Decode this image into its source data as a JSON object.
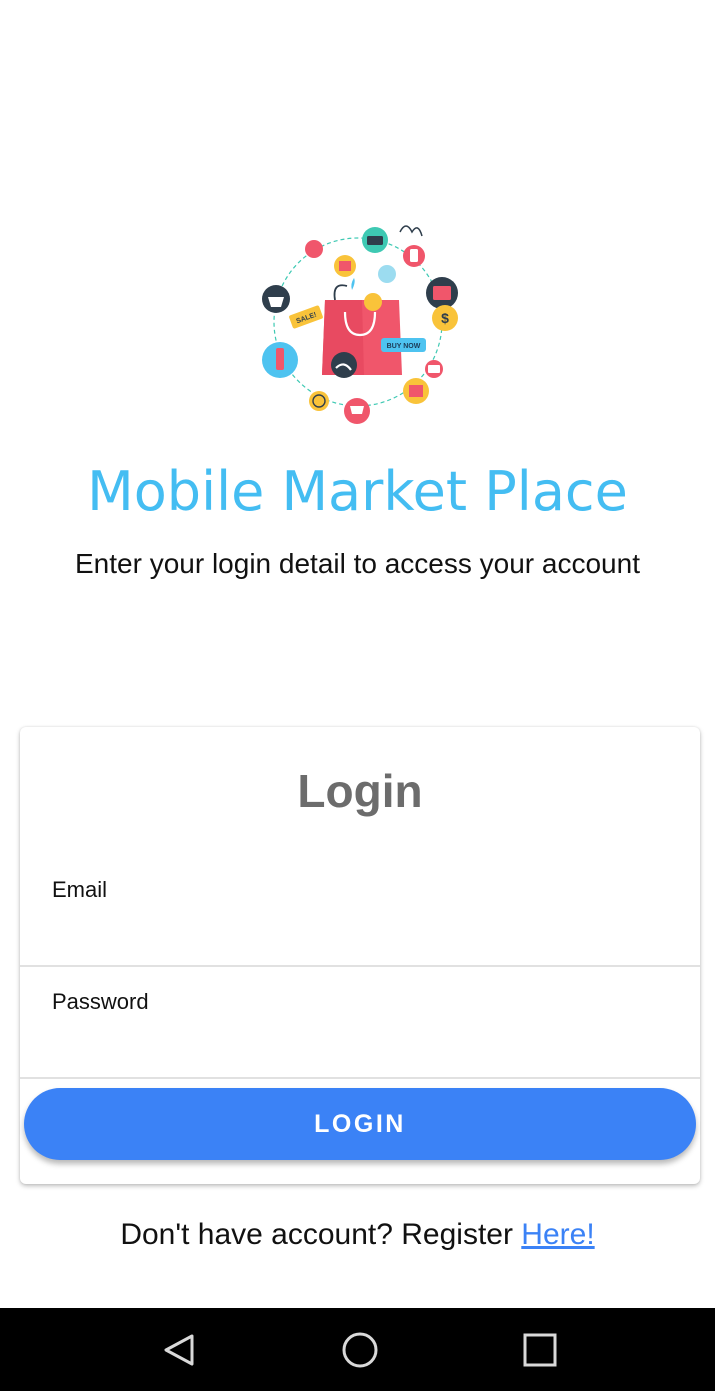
{
  "app": {
    "title": "Mobile Market Place",
    "subtitle": "Enter your login detail to access your account"
  },
  "hero": {
    "icon": "shopping-illustration",
    "sale_tag": "SALE!",
    "buy_now_tag": "BUY NOW"
  },
  "login_card": {
    "title": "Login",
    "email_label": "Email",
    "email_value": "",
    "password_label": "Password",
    "password_value": "",
    "button_label": "LOGIN"
  },
  "register": {
    "prompt": "Don't have account? Register",
    "link_label": "Here!"
  },
  "navbar": {
    "back_icon": "back-triangle-icon",
    "home_icon": "home-circle-icon",
    "recents_icon": "recents-square-icon"
  },
  "colors": {
    "title": "#44bdf2",
    "primary": "#3b82f6",
    "card_title": "#6c6c6c",
    "navbar": "#000000"
  }
}
